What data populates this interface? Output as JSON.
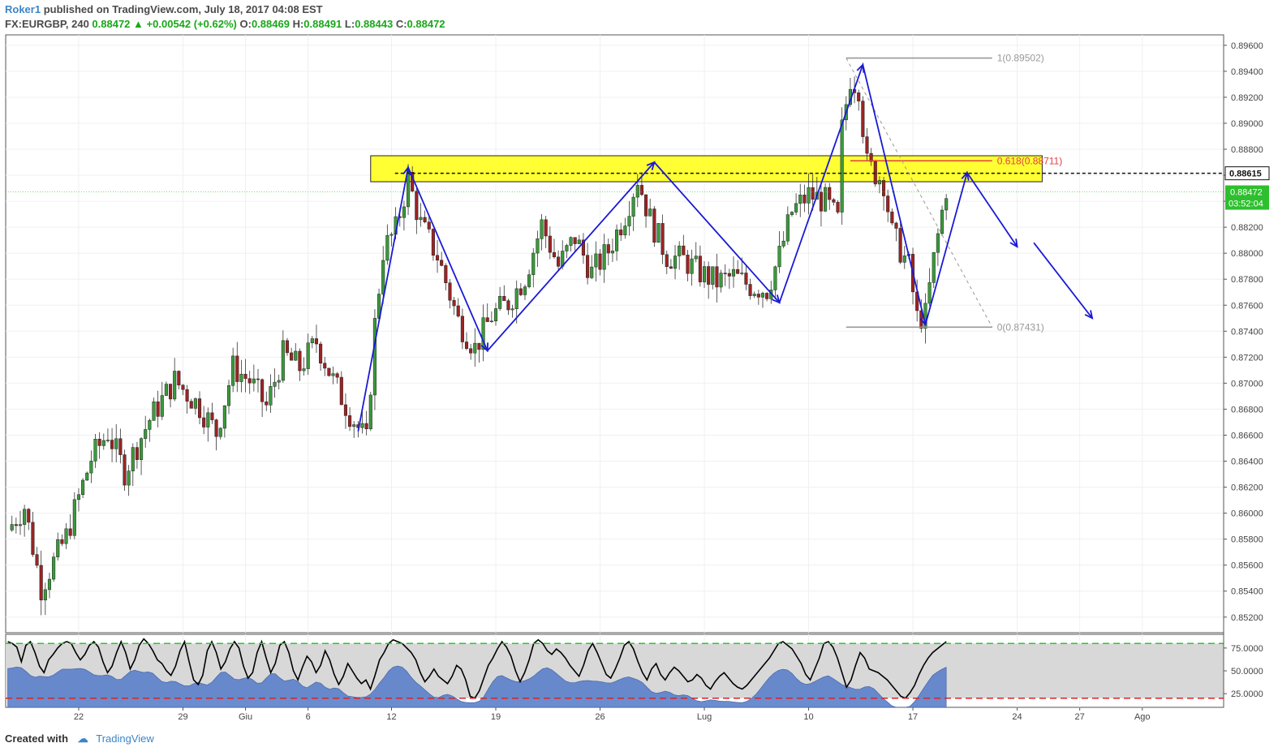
{
  "header": {
    "author": "Roker1",
    "published": "published on TradingView.com, July 18, 2017 04:08 EST",
    "symbol": "FX:EURGBP, 240",
    "last": "0.88472",
    "change": "+0.00542 (+0.62%)",
    "o_label": "O:",
    "o": "0.88469",
    "h_label": "H:",
    "h": "0.88491",
    "l_label": "L:",
    "l": "0.88443",
    "c_label": "C:",
    "c": "0.88472"
  },
  "footer": {
    "created_with": "Created with",
    "brand": "TradingView"
  },
  "colors": {
    "up": "#3a9a3a",
    "down": "#9c2323",
    "zone": "#ffff33",
    "pattern": "#1a1ad6",
    "fib_line": "#999999",
    "fib_618": "#e04040",
    "osc_fill": "#5b7fc9",
    "osc_line": "#000000",
    "band_top": "#22cc22",
    "band_bottom": "#dd2222"
  },
  "chart_data": [
    {
      "type": "candlestick",
      "ylim": [
        0.8508,
        0.8968
      ],
      "y_ticks": [
        "0.89600",
        "0.89400",
        "0.89200",
        "0.89000",
        "0.88800",
        "0.88600",
        "0.88400",
        "0.88200",
        "0.88000",
        "0.87800",
        "0.87600",
        "0.87400",
        "0.87200",
        "0.87000",
        "0.86800",
        "0.86600",
        "0.86400",
        "0.86200",
        "0.86000",
        "0.85800",
        "0.85600",
        "0.85400",
        "0.85200"
      ],
      "x_labels": [
        {
          "label": "22",
          "bar": 17
        },
        {
          "label": "29",
          "bar": 42
        },
        {
          "label": "Giu",
          "bar": 57
        },
        {
          "label": "6",
          "bar": 72
        },
        {
          "label": "12",
          "bar": 92
        },
        {
          "label": "19",
          "bar": 117
        },
        {
          "label": "26",
          "bar": 142
        },
        {
          "label": "Lug",
          "bar": 167
        },
        {
          "label": "10",
          "bar": 192
        },
        {
          "label": "17",
          "bar": 217
        },
        {
          "label": "24",
          "bar": 242
        },
        {
          "label": "27",
          "bar": 257
        },
        {
          "label": "Ago",
          "bar": 272
        }
      ],
      "bar_count": 292,
      "path": [
        [
          0,
          0.8587
        ],
        [
          4,
          0.8605
        ],
        [
          8,
          0.8543
        ],
        [
          14,
          0.8582
        ],
        [
          20,
          0.8642
        ],
        [
          24,
          0.8662
        ],
        [
          28,
          0.8632
        ],
        [
          34,
          0.8672
        ],
        [
          40,
          0.8702
        ],
        [
          46,
          0.8682
        ],
        [
          50,
          0.8662
        ],
        [
          54,
          0.8712
        ],
        [
          58,
          0.8702
        ],
        [
          62,
          0.8682
        ],
        [
          66,
          0.8722
        ],
        [
          70,
          0.8712
        ],
        [
          74,
          0.8732
        ],
        [
          78,
          0.8702
        ],
        [
          82,
          0.8677
        ],
        [
          86,
          0.8655
        ],
        [
          88,
          0.8745
        ],
        [
          90,
          0.8802
        ],
        [
          93,
          0.8818
        ],
        [
          96,
          0.8857
        ],
        [
          99,
          0.8822
        ],
        [
          103,
          0.8798
        ],
        [
          108,
          0.8748
        ],
        [
          112,
          0.8727
        ],
        [
          116,
          0.8752
        ],
        [
          120,
          0.8762
        ],
        [
          124,
          0.8782
        ],
        [
          128,
          0.8822
        ],
        [
          132,
          0.879
        ],
        [
          136,
          0.8812
        ],
        [
          140,
          0.8785
        ],
        [
          144,
          0.8802
        ],
        [
          148,
          0.883
        ],
        [
          151,
          0.8858
        ],
        [
          154,
          0.8826
        ],
        [
          158,
          0.8798
        ],
        [
          162,
          0.8795
        ],
        [
          166,
          0.8785
        ],
        [
          170,
          0.8778
        ],
        [
          174,
          0.8782
        ],
        [
          178,
          0.8775
        ],
        [
          182,
          0.8772
        ],
        [
          185,
          0.8798
        ],
        [
          188,
          0.8832
        ],
        [
          192,
          0.8845
        ],
        [
          196,
          0.884
        ],
        [
          199,
          0.8825
        ],
        [
          200,
          0.8895
        ],
        [
          202,
          0.8935
        ],
        [
          204,
          0.8928
        ],
        [
          206,
          0.8868
        ],
        [
          210,
          0.8855
        ],
        [
          212,
          0.8815
        ],
        [
          216,
          0.879
        ],
        [
          218,
          0.875
        ],
        [
          220,
          0.8752
        ],
        [
          222,
          0.8795
        ],
        [
          225,
          0.885
        ]
      ],
      "support_resistance_zone": {
        "from": 0.8855,
        "to": 0.8875,
        "start_bar": 87,
        "end_bar": 248
      },
      "dashed_level": {
        "value": 0.88615,
        "label": "0.88615"
      },
      "last_price": {
        "value": 0.88472,
        "label": "0.88472",
        "countdown": "03:52:04"
      },
      "fibonacci": {
        "start_bar": 201,
        "end_bar": 236,
        "levels": [
          {
            "ratio": "1",
            "value": 0.89502,
            "label": "1(0.89502)"
          },
          {
            "ratio": "0.618",
            "value": 0.88711,
            "label": "0.618(0.88711)"
          },
          {
            "ratio": "0",
            "value": 0.87431,
            "label": "0(0.87431)"
          }
        ]
      },
      "pattern_line": [
        [
          84,
          0.8663
        ],
        [
          96,
          0.8866
        ],
        [
          115,
          0.8725
        ],
        [
          155,
          0.887
        ],
        [
          185,
          0.8762
        ],
        [
          205,
          0.8945
        ],
        [
          220,
          0.8745
        ],
        [
          230,
          0.8862
        ],
        [
          242,
          0.8805
        ]
      ],
      "projection_arrow": [
        [
          246,
          0.8808
        ],
        [
          260,
          0.875
        ]
      ]
    },
    {
      "type": "area",
      "name": "oscillator",
      "ylim": [
        10,
        90
      ],
      "y_ticks": [
        "75.0000",
        "50.0000",
        "25.0000"
      ],
      "band": {
        "top": 80,
        "bottom": 20
      },
      "line_values": [
        82,
        80,
        76,
        60,
        78,
        82,
        70,
        55,
        48,
        62,
        68,
        75,
        80,
        82,
        80,
        70,
        62,
        68,
        78,
        82,
        76,
        60,
        48,
        55,
        70,
        82,
        70,
        52,
        62,
        78,
        85,
        80,
        72,
        62,
        58,
        50,
        45,
        55,
        72,
        82,
        60,
        40,
        35,
        45,
        72,
        82,
        70,
        52,
        60,
        74,
        82,
        75,
        55,
        42,
        48,
        70,
        82,
        64,
        48,
        58,
        78,
        82,
        70,
        50,
        40,
        54,
        66,
        60,
        48,
        56,
        72,
        62,
        46,
        35,
        44,
        58,
        50,
        42,
        36,
        40,
        30,
        45,
        62,
        70,
        80,
        84,
        82,
        80,
        75,
        70,
        62,
        48,
        38,
        44,
        52,
        44,
        40,
        36,
        44,
        56,
        52,
        40,
        22,
        20,
        28,
        42,
        56,
        64,
        74,
        82,
        76,
        66,
        50,
        38,
        48,
        62,
        80,
        84,
        80,
        72,
        68,
        74,
        70,
        64,
        56,
        50,
        44,
        56,
        72,
        80,
        70,
        58,
        46,
        42,
        52,
        64,
        78,
        82,
        74,
        60,
        48,
        40,
        52,
        58,
        46,
        40,
        48,
        54,
        50,
        44,
        38,
        40,
        46,
        42,
        34,
        30,
        38,
        44,
        48,
        42,
        36,
        32,
        30,
        34,
        40,
        46,
        52,
        58,
        64,
        72,
        80,
        82,
        78,
        74,
        66,
        58,
        46,
        40,
        52,
        64,
        80,
        82,
        76,
        64,
        48,
        32,
        40,
        56,
        70,
        64,
        52,
        50,
        48,
        44,
        40,
        34,
        28,
        22,
        20,
        26,
        34,
        46,
        56,
        64,
        70,
        74,
        78,
        82
      ]
    }
  ]
}
